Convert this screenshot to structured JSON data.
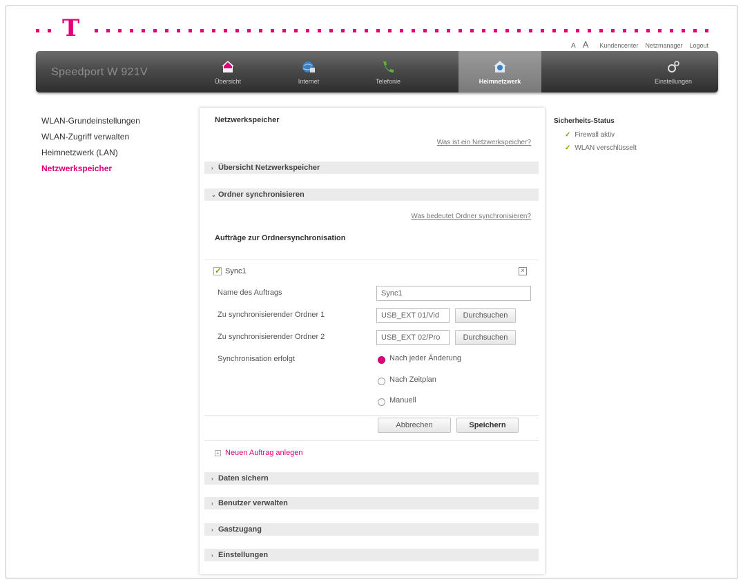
{
  "brand": {
    "product": "Speedport W 921V",
    "accent": "#e2007a"
  },
  "toplinks": {
    "font_small": "A",
    "font_large": "A",
    "items": [
      "Kundencenter",
      "Netzmanager",
      "Logout"
    ]
  },
  "nav": {
    "tabs": [
      {
        "label": "Übersicht",
        "icon": "home-icon"
      },
      {
        "label": "Internet",
        "icon": "globe-icon"
      },
      {
        "label": "Telefonie",
        "icon": "phone-icon"
      },
      {
        "label": "Heimnetzwerk",
        "icon": "network-house-icon",
        "active": true
      },
      {
        "label": "Einstellungen",
        "icon": "gears-icon"
      }
    ]
  },
  "sidebar": {
    "items": [
      {
        "label": "WLAN-Grundeinstellungen"
      },
      {
        "label": "WLAN-Zugriff verwalten"
      },
      {
        "label": "Heimnetzwerk (LAN)"
      },
      {
        "label": "Netzwerkspeicher",
        "active": true
      }
    ]
  },
  "main": {
    "title": "Netzwerkspeicher",
    "help_link": "Was ist ein Netzwerkspeicher?",
    "sections": {
      "overview": "Übersicht Netzwerkspeicher",
      "sync": "Ordner synchronisieren",
      "backup": "Daten sichern",
      "users": "Benutzer verwalten",
      "guest": "Gastzugang",
      "settings": "Einstellungen"
    },
    "sync_help_link": "Was bedeutet Ordner synchronisieren?",
    "jobs_heading": "Aufträge zur Ordnersynchronisation",
    "job": {
      "name": "Sync1",
      "checked": true,
      "name_label": "Name des Auftrags",
      "name_value": "Sync1",
      "folder1_label": "Zu synchronisierender Ordner 1",
      "folder1_value": "USB_EXT 01/Vid",
      "folder2_label": "Zu synchronisierender Ordner 2",
      "folder2_value": "USB_EXT 02/Pro",
      "browse_label": "Durchsuchen",
      "mode_label": "Synchronisation erfolgt",
      "modes": [
        {
          "label": "Nach jeder Änderung",
          "selected": true
        },
        {
          "label": "Nach Zeitplan",
          "selected": false
        },
        {
          "label": "Manuell",
          "selected": false
        }
      ],
      "cancel_label": "Abbrechen",
      "save_label": "Speichern"
    },
    "new_job_label": "Neuen Auftrag anlegen"
  },
  "status": {
    "title": "Sicherheits-Status",
    "items": [
      "Firewall aktiv",
      "WLAN verschlüsselt"
    ]
  }
}
